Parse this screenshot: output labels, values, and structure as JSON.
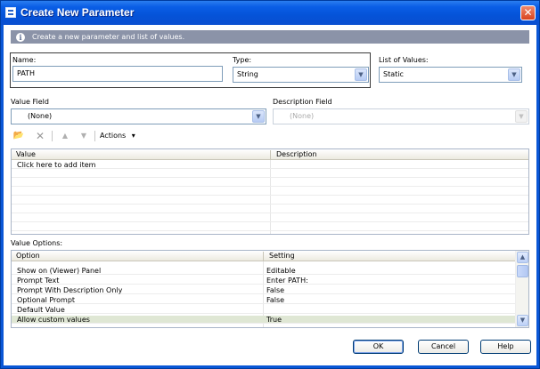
{
  "window": {
    "title": "Create New Parameter",
    "close_glyph": "✕"
  },
  "info": {
    "text": "Create a new parameter and list of values."
  },
  "fields": {
    "name": {
      "label": "Name:",
      "value": "PATH"
    },
    "type": {
      "label": "Type:",
      "value": "String"
    },
    "list_of_values": {
      "label": "List of Values:",
      "value": "Static"
    },
    "value_field": {
      "label": "Value Field",
      "value": "(None)"
    },
    "description_field": {
      "label": "Description Field",
      "value": "(None)"
    }
  },
  "toolbar": {
    "icons": [
      "import-icon",
      "delete-icon",
      "move-up-icon",
      "move-down-icon"
    ],
    "actions_label": "Actions",
    "actions_arrow": "▾"
  },
  "values_grid": {
    "columns": [
      "Value",
      "Description"
    ],
    "placeholder_row": "Click here to add item"
  },
  "value_options": {
    "label": "Value Options:",
    "columns": [
      "Option",
      "Setting"
    ],
    "rows": [
      {
        "option": "Show on (Viewer) Panel",
        "setting": "Editable"
      },
      {
        "option": "Prompt Text",
        "setting": "Enter PATH:"
      },
      {
        "option": "Prompt With Description Only",
        "setting": "False"
      },
      {
        "option": "Optional Prompt",
        "setting": "False"
      },
      {
        "option": "Default Value",
        "setting": ""
      },
      {
        "option": "Allow custom values",
        "setting": "True"
      }
    ]
  },
  "buttons": {
    "ok": "OK",
    "cancel": "Cancel",
    "help": "Help"
  },
  "colors": {
    "titlebar": "#0553d8",
    "infobar": "#8b93a8",
    "selected_row": "#dfe7d4"
  }
}
